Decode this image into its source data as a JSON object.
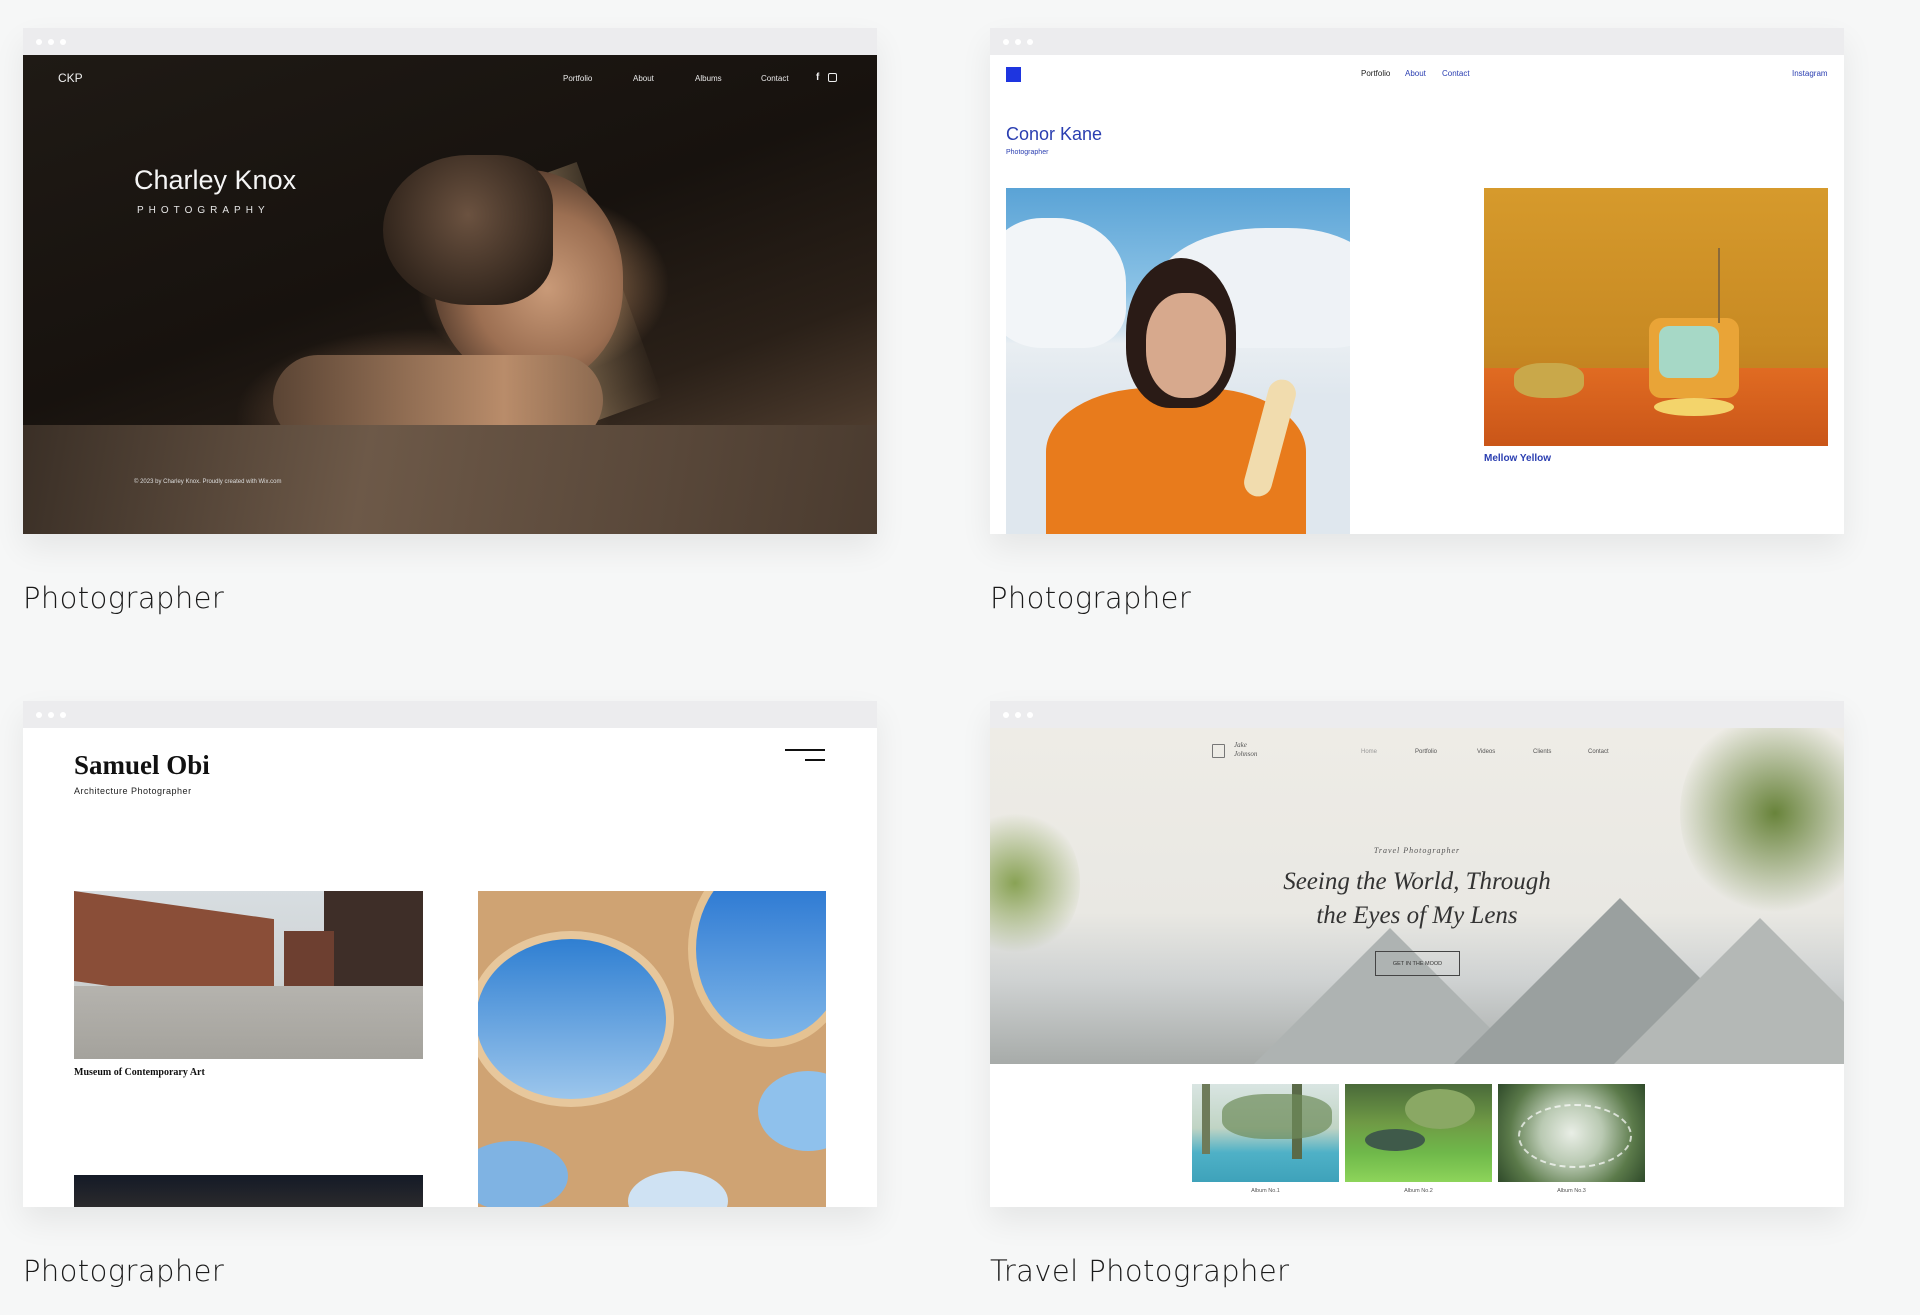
{
  "colors": {
    "page_bg": "#f6f7f7",
    "accent_blue": "#2a3eb1",
    "dark_photo": "#1a1511",
    "mustard": "#c98a22"
  },
  "templates": [
    {
      "caption": "Photographer",
      "logo": "CKP",
      "nav": [
        "Portfolio",
        "About",
        "Albums",
        "Contact"
      ],
      "social_icons": [
        "facebook-icon",
        "instagram-icon"
      ],
      "title": "Charley Knox",
      "subtitle": "PHOTOGRAPHY",
      "footer": "© 2023 by Charley Knox. Proudly created with Wix.com"
    },
    {
      "caption": "Photographer",
      "nav": [
        "Portfolio",
        "About",
        "Contact"
      ],
      "social": "Instagram",
      "title": "Conor Kane",
      "subtitle": "Photographer",
      "gallery_caption": "Mellow Yellow"
    },
    {
      "caption": "Photographer",
      "title": "Samuel Obi",
      "subtitle": "Architecture Photographer",
      "project_caption": "Museum of Contemporary Art",
      "menu_icon": "hamburger-menu-icon"
    },
    {
      "caption": "Travel Photographer",
      "logo_line1": "Jake",
      "logo_line2": "Johnson",
      "nav": [
        "Home",
        "Portfolio",
        "Videos",
        "Clients",
        "Contact"
      ],
      "kicker": "Travel Photographer",
      "headline_line1": "Seeing the World, Through",
      "headline_line2": "the Eyes of My Lens",
      "cta": "GET IN THE MOOD",
      "albums": [
        "Album No.1",
        "Album No.2",
        "Album No.3"
      ]
    }
  ]
}
